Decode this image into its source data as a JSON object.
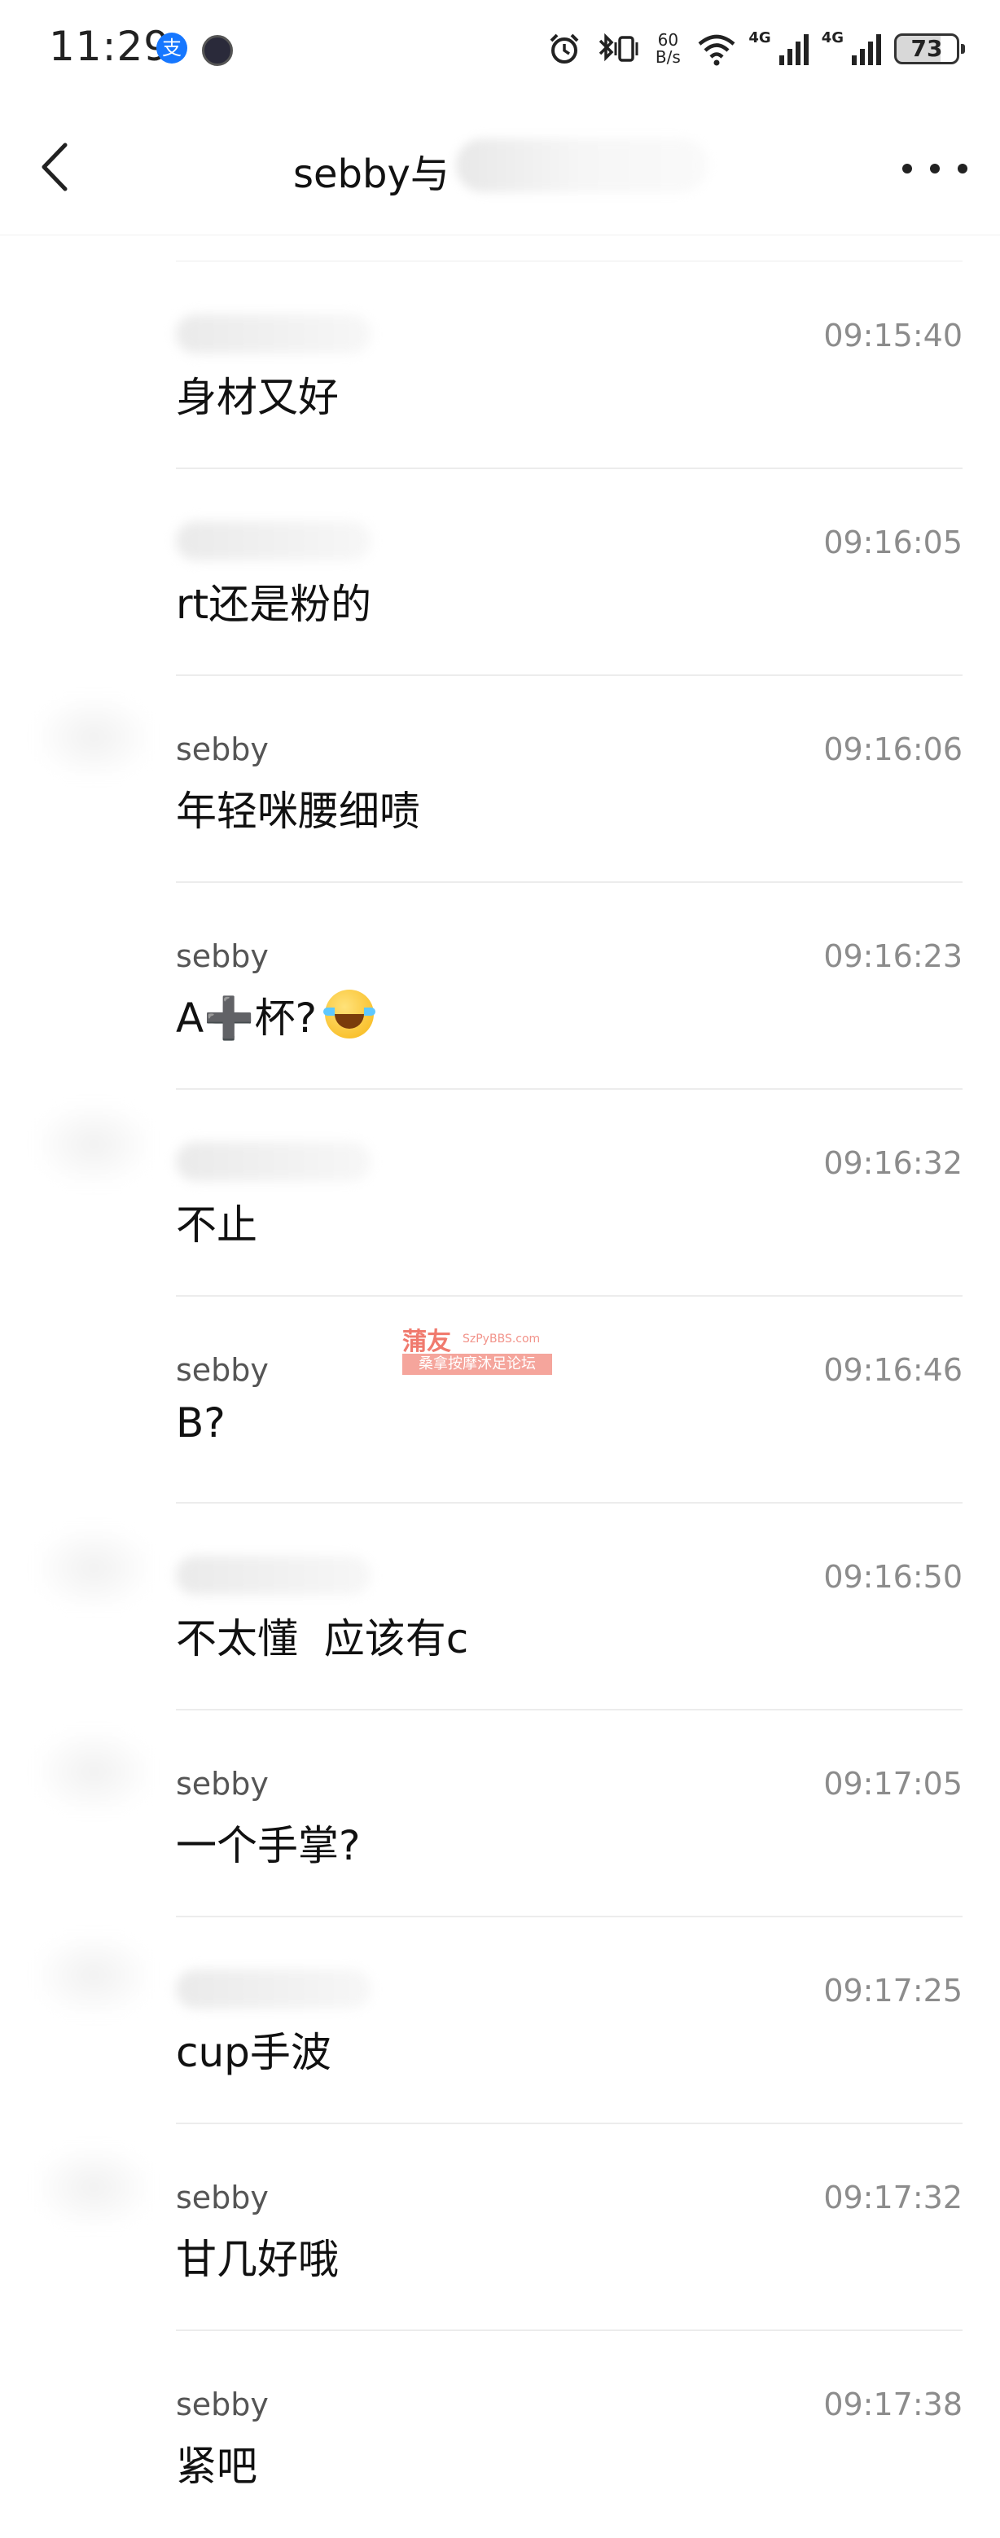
{
  "status_bar": {
    "time": "11:29",
    "net_speed_value": "60",
    "net_speed_unit": "B/s",
    "network_1": "4G",
    "network_2": "4G",
    "battery": "73"
  },
  "header": {
    "title": "sebby与"
  },
  "messages": [
    {
      "sender": "",
      "time": "09:15:40",
      "text": "身材又好"
    },
    {
      "sender": "",
      "time": "09:16:05",
      "text": "rt还是粉的"
    },
    {
      "sender": "sebby",
      "time": "09:16:06",
      "text": "年轻咪腰细啧"
    },
    {
      "sender": "sebby",
      "time": "09:16:23",
      "text": "A➕杯?"
    },
    {
      "sender": "",
      "time": "09:16:32",
      "text": "不止"
    },
    {
      "sender": "sebby",
      "time": "09:16:46",
      "text": "B?"
    },
    {
      "sender": "",
      "time": "09:16:50",
      "text": "不太懂  应该有c"
    },
    {
      "sender": "sebby",
      "time": "09:17:05",
      "text": "一个手掌?"
    },
    {
      "sender": "",
      "time": "09:17:25",
      "text": "cup手波"
    },
    {
      "sender": "sebby",
      "time": "09:17:32",
      "text": "甘几好哦"
    },
    {
      "sender": "sebby",
      "time": "09:17:38",
      "text": "紧吧"
    }
  ],
  "watermark": {
    "brand": "蒲友",
    "url": "SzPyBBS.com",
    "tagline": "桑拿按摩沐足论坛"
  }
}
